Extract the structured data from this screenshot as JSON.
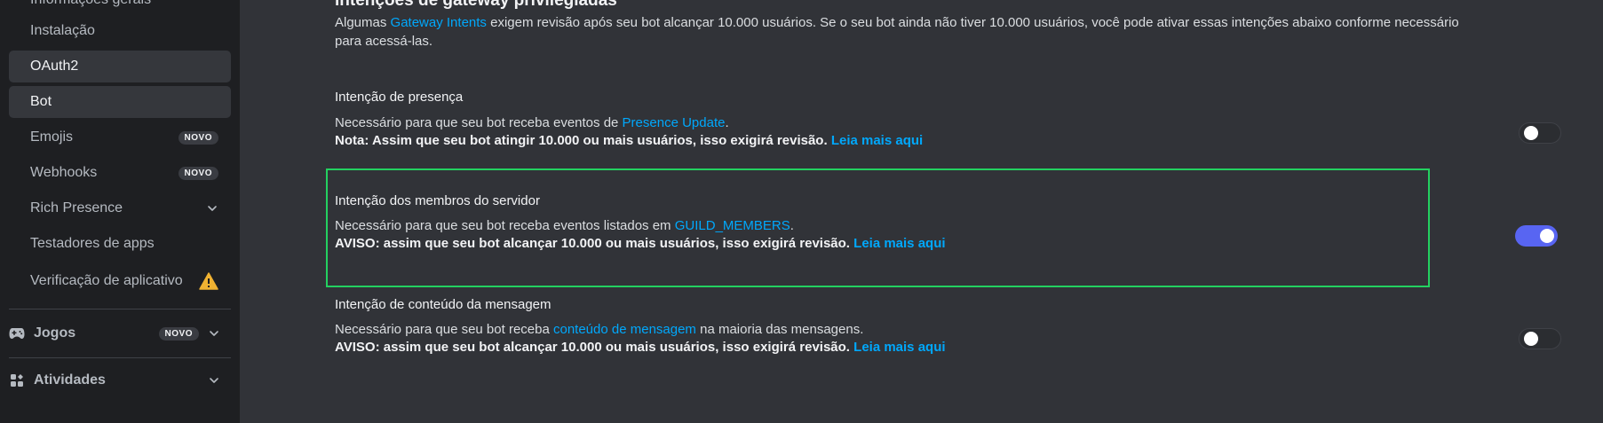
{
  "sidebar": {
    "partial_item": "Informações gerais",
    "items": [
      {
        "label": "Instalação"
      },
      {
        "label": "OAuth2"
      },
      {
        "label": "Bot"
      },
      {
        "label": "Emojis",
        "badge": "NOVO"
      },
      {
        "label": "Webhooks",
        "badge": "NOVO"
      },
      {
        "label": "Rich Presence"
      },
      {
        "label": "Testadores de apps"
      },
      {
        "label": "Verificação de aplicativo"
      }
    ],
    "sections": [
      {
        "label": "Jogos",
        "badge": "NOVO"
      },
      {
        "label": "Atividades"
      }
    ]
  },
  "main": {
    "heading": "Intenções de gateway privilegiadas",
    "intro": {
      "before": "Algumas ",
      "link": "Gateway Intents",
      "after": " exigem revisão após seu bot alcançar 10.000 usuários. Se o seu bot ainda não tiver 10.000 usuários, você pode ativar essas intenções abaixo conforme necessário para acessá-las."
    },
    "intents": [
      {
        "title": "Intenção de presença",
        "desc_before": "Necessário para que seu bot receba eventos de ",
        "desc_link": "Presence Update",
        "desc_after": ".",
        "note": "Nota: Assim que seu bot atingir 10.000 ou mais usuários, isso exigirá revisão.",
        "note_link": "Leia mais aqui",
        "enabled": false
      },
      {
        "title": "Intenção dos membros do servidor",
        "desc_before": "Necessário para que seu bot receba eventos listados em ",
        "desc_link": "GUILD_MEMBERS",
        "desc_after": ".",
        "note": "AVISO: assim que seu bot alcançar 10.000 ou mais usuários, isso exigirá revisão.",
        "note_link": "Leia mais aqui",
        "enabled": true
      },
      {
        "title": "Intenção de conteúdo da mensagem",
        "desc_before": "Necessário para que seu bot receba ",
        "desc_link": "conteúdo de mensagem",
        "desc_after": " na maioria das mensagens.",
        "note": "AVISO: assim que seu bot alcançar 10.000 ou mais usuários, isso exigirá revisão.",
        "note_link": "Leia mais aqui",
        "enabled": false
      }
    ]
  },
  "colors": {
    "accent": "#5865f2",
    "link": "#00a8fc",
    "highlight_border": "#23d160",
    "warning": "#f0b232"
  }
}
